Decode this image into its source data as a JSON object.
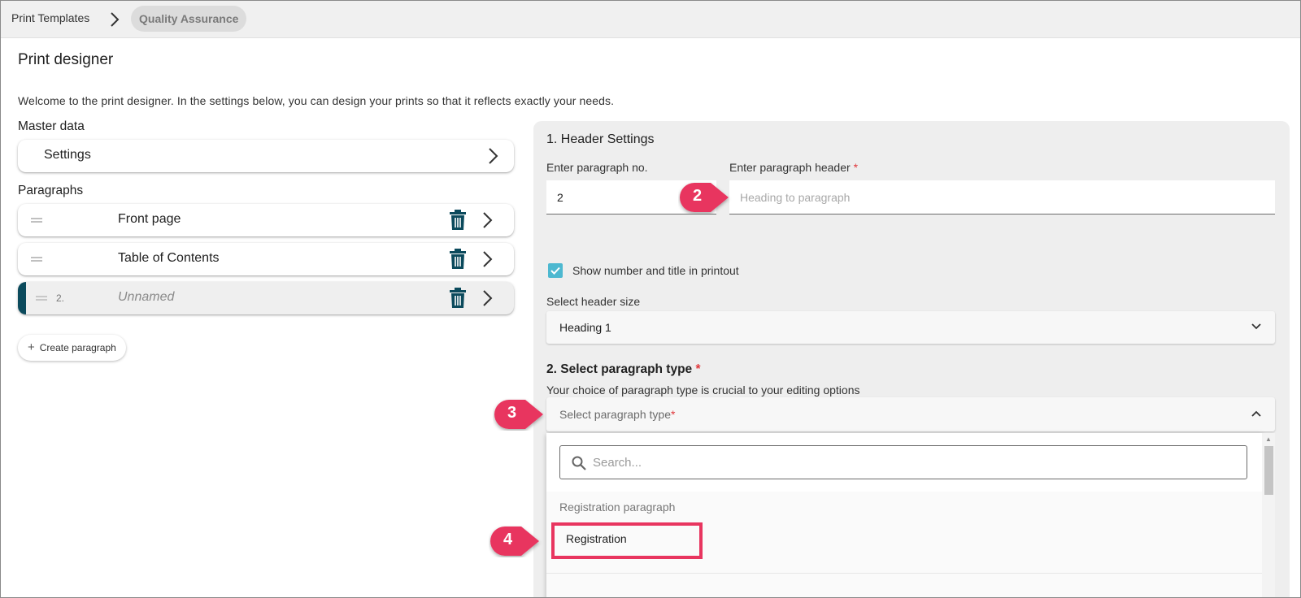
{
  "breadcrumb": {
    "parent": "Print Templates",
    "current": "Quality Assurance"
  },
  "page": {
    "title": "Print designer",
    "welcome": "Welcome to the print designer. In the settings below, you can design your prints so that it reflects exactly your needs."
  },
  "master_data": {
    "label": "Master data",
    "settings_label": "Settings"
  },
  "paragraphs": {
    "label": "Paragraphs",
    "items": [
      {
        "number": "",
        "label": "Front page"
      },
      {
        "number": "",
        "label": "Table of Contents"
      },
      {
        "number": "2.",
        "label": "Unnamed"
      }
    ],
    "create_label": "Create paragraph"
  },
  "header_settings": {
    "heading": "1. Header Settings",
    "paragraph_no_label": "Enter paragraph no.",
    "paragraph_no_value": "2",
    "paragraph_header_label": "Enter paragraph header",
    "required_mark": "*",
    "paragraph_header_placeholder": "Heading to paragraph",
    "show_number_label": "Show number and title in printout",
    "show_number_checked": true,
    "header_size_label": "Select header size",
    "header_size_value": "Heading 1"
  },
  "paragraph_type": {
    "heading": "2. Select paragraph type",
    "required_mark": "*",
    "description": "Your choice of paragraph type is crucial to your editing options",
    "select_placeholder": "Select paragraph type",
    "search_placeholder": "Search...",
    "group_label": "Registration paragraph",
    "option": "Registration"
  },
  "callouts": [
    "2",
    "3",
    "4"
  ],
  "colors": {
    "accent": "#0b4a5c",
    "callout": "#e8355f",
    "checkbox": "#4db8d0",
    "required": "#e0383c"
  }
}
